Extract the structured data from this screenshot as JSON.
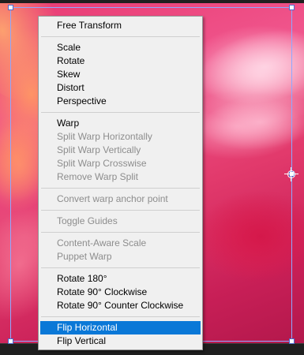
{
  "menu": {
    "groups": [
      {
        "items": [
          {
            "label": "Free Transform",
            "enabled": true
          }
        ]
      },
      {
        "items": [
          {
            "label": "Scale",
            "enabled": true
          },
          {
            "label": "Rotate",
            "enabled": true
          },
          {
            "label": "Skew",
            "enabled": true
          },
          {
            "label": "Distort",
            "enabled": true
          },
          {
            "label": "Perspective",
            "enabled": true
          }
        ]
      },
      {
        "items": [
          {
            "label": "Warp",
            "enabled": true
          },
          {
            "label": "Split Warp Horizontally",
            "enabled": false
          },
          {
            "label": "Split Warp Vertically",
            "enabled": false
          },
          {
            "label": "Split Warp Crosswise",
            "enabled": false
          },
          {
            "label": "Remove Warp Split",
            "enabled": false
          }
        ]
      },
      {
        "items": [
          {
            "label": "Convert warp anchor point",
            "enabled": false
          }
        ]
      },
      {
        "items": [
          {
            "label": "Toggle Guides",
            "enabled": false
          }
        ]
      },
      {
        "items": [
          {
            "label": "Content-Aware Scale",
            "enabled": false
          },
          {
            "label": "Puppet Warp",
            "enabled": false
          }
        ]
      },
      {
        "items": [
          {
            "label": "Rotate 180°",
            "enabled": true
          },
          {
            "label": "Rotate 90° Clockwise",
            "enabled": true
          },
          {
            "label": "Rotate 90° Counter Clockwise",
            "enabled": true
          }
        ]
      },
      {
        "items": [
          {
            "label": "Flip Horizontal",
            "enabled": true,
            "highlighted": true
          },
          {
            "label": "Flip Vertical",
            "enabled": true
          }
        ]
      }
    ]
  },
  "colors": {
    "highlight": "#0a78d7",
    "disabled_text": "#8d8d8d",
    "menu_background": "#f0f0f0",
    "bounding_box": "#8fa8ff"
  }
}
